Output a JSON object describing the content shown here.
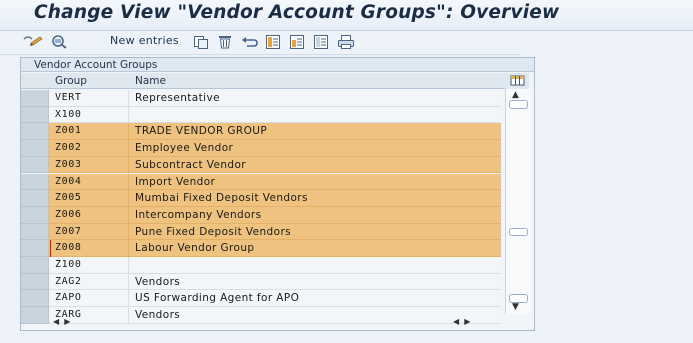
{
  "window": {
    "title": "Change View \"Vendor Account Groups\": Overview"
  },
  "toolbar": {
    "new_entries_label": "New entries",
    "icons": [
      "display-change-icon",
      "other-view-icon",
      "copy-icon",
      "delete-icon",
      "undo-icon",
      "select-all-icon",
      "select-block-icon",
      "deselect-all-icon",
      "print-icon"
    ]
  },
  "table": {
    "title": "Vendor Account Groups",
    "columns": [
      "Group",
      "Name"
    ],
    "rows": [
      {
        "group": "VERT",
        "name": "Representative",
        "selected": false
      },
      {
        "group": "X100",
        "name": "",
        "selected": false
      },
      {
        "group": "Z001",
        "name": "TRADE VENDOR GROUP",
        "selected": true
      },
      {
        "group": "Z002",
        "name": "Employee Vendor",
        "selected": true
      },
      {
        "group": "Z003",
        "name": "Subcontract Vendor",
        "selected": true
      },
      {
        "group": "Z004",
        "name": "Import Vendor",
        "selected": true
      },
      {
        "group": "Z005",
        "name": "Mumbai Fixed Deposit Vendors",
        "selected": true
      },
      {
        "group": "Z006",
        "name": "Intercompany Vendors",
        "selected": true
      },
      {
        "group": "Z007",
        "name": "Pune Fixed Deposit Vendors",
        "selected": true
      },
      {
        "group": "Z008",
        "name": "Labour Vendor Group",
        "selected": true
      },
      {
        "group": "Z100",
        "name": "",
        "selected": false
      },
      {
        "group": "ZAG2",
        "name": "Vendors",
        "selected": false
      },
      {
        "group": "ZAPO",
        "name": "US Forwarding Agent for APO",
        "selected": false
      },
      {
        "group": "ZARG",
        "name": "Vendors",
        "selected": false
      }
    ]
  },
  "colors": {
    "highlight": "#efc37f",
    "title_text": "#1b2d44",
    "panel_border": "#a9bccf"
  }
}
